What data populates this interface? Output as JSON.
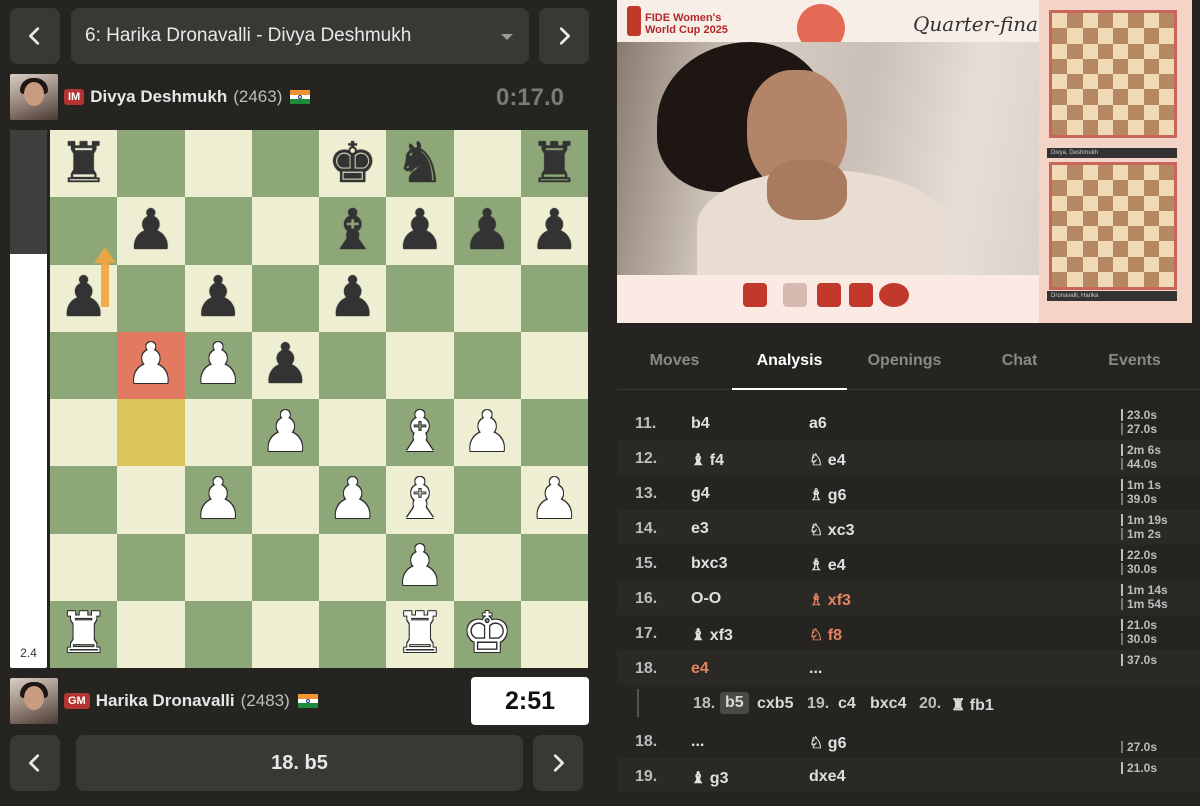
{
  "game_select": {
    "label": "6: Harika Dronavalli - Divya Deshmukh"
  },
  "top_player": {
    "title": "IM",
    "name": "Divya Deshmukh",
    "rating": "(2463)",
    "clock": "0:17.0"
  },
  "bottom_player": {
    "title": "GM",
    "name": "Harika Dronavalli",
    "rating": "(2483)",
    "clock": "2:51"
  },
  "eval": {
    "score": "2.4",
    "white_share": 0.77
  },
  "board": {
    "ranks": [
      [
        "br",
        "",
        "",
        "",
        "bk",
        "bn",
        "",
        "br"
      ],
      [
        "",
        "bp",
        "",
        "",
        "bb",
        "bp",
        "bp",
        "bp"
      ],
      [
        "bp",
        "",
        "bp",
        "",
        "bp",
        "",
        "",
        ""
      ],
      [
        "",
        "wp",
        "wp",
        "bp",
        "",
        "",
        "",
        ""
      ],
      [
        "",
        "",
        "",
        "wp",
        "",
        "wb",
        "wp",
        ""
      ],
      [
        "",
        "",
        "wp",
        "",
        "wp",
        "wb",
        "",
        "wp"
      ],
      [
        "",
        "",
        "",
        "",
        "",
        "wp",
        "",
        ""
      ],
      [
        "wr",
        "",
        "",
        "",
        "",
        "wr",
        "wk",
        ""
      ]
    ],
    "highlight_from": "b4",
    "highlight_to": "b5"
  },
  "move_bar": {
    "label": "18. b5"
  },
  "video": {
    "event_line1": "FIDE Women's",
    "event_line2": "World Cup 2025",
    "round": "Quarter-finals",
    "mini_label_top": "Divya, Deshmukh",
    "mini_label_bottom": "Dronavalli, Harika"
  },
  "tabs": [
    "Moves",
    "Analysis",
    "Openings",
    "Chat",
    "Events"
  ],
  "active_tab": "Analysis",
  "moves": [
    {
      "num": "11.",
      "white": "b4",
      "black": "a6",
      "t1": "23.0s",
      "t2": "27.0s"
    },
    {
      "num": "12.",
      "white": "♝ f4",
      "black": "♘ e4",
      "t1": "2m 6s",
      "t2": "44.0s"
    },
    {
      "num": "13.",
      "white": "g4",
      "black": "♗ g6",
      "t1": "1m 1s",
      "t2": "39.0s"
    },
    {
      "num": "14.",
      "white": "e3",
      "black": "♘ xc3",
      "t1": "1m 19s",
      "t2": "1m 2s"
    },
    {
      "num": "15.",
      "white": "bxc3",
      "black": "♗ e4",
      "t1": "22.0s",
      "t2": "30.0s"
    },
    {
      "num": "16.",
      "white": "O-O",
      "black": "♗ xf3",
      "t1": "1m 14s",
      "t2": "1m 54s"
    },
    {
      "num": "17.",
      "white": "♝ xf3",
      "black": "♘ f8",
      "t1": "21.0s",
      "t2": "30.0s"
    },
    {
      "num": "18.",
      "white": "e4",
      "black": "...",
      "t1": "37.0s",
      "t2": ""
    }
  ],
  "variation": {
    "n1": "18.",
    "m1": "b5",
    "m2": "cxb5",
    "n2": "19.",
    "m3": "c4",
    "m4": "bxc4",
    "n3": "20.",
    "m5": "♜ fb1"
  },
  "moves_after": [
    {
      "num": "18.",
      "white": "...",
      "black": "♘ g6",
      "t1": "",
      "t2": "27.0s"
    },
    {
      "num": "19.",
      "white": "♝ g3",
      "black": "dxe4",
      "t1": "21.0s",
      "t2": ""
    }
  ]
}
